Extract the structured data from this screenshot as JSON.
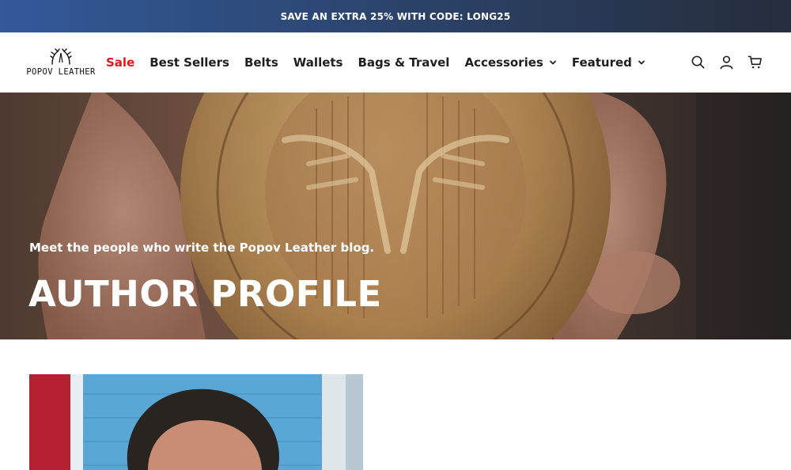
{
  "announcement": {
    "text": "SAVE AN EXTRA 25% WITH CODE: LONG25"
  },
  "header": {
    "logo_text": "POPOV LEATHER",
    "nav": [
      {
        "label": "Sale",
        "has_dropdown": false,
        "color": "#e0181e"
      },
      {
        "label": "Best Sellers",
        "has_dropdown": false
      },
      {
        "label": "Belts",
        "has_dropdown": false
      },
      {
        "label": "Wallets",
        "has_dropdown": false
      },
      {
        "label": "Bags & Travel",
        "has_dropdown": false
      },
      {
        "label": "Accessories",
        "has_dropdown": true
      },
      {
        "label": "Featured",
        "has_dropdown": true
      }
    ],
    "icons": [
      "search-icon",
      "account-icon",
      "cart-icon"
    ]
  },
  "hero": {
    "subtitle": "Meet the people who write the Popov Leather blog.",
    "title": "AUTHOR PROFILE",
    "image_subject": "hand holding brass logo stamp"
  },
  "author": {
    "image_subject": "author portrait photo"
  },
  "colors": {
    "announce_start": "#33599a",
    "announce_end": "#262d3c",
    "sale_red": "#e0181e",
    "text_dark": "#1f1f1f"
  }
}
